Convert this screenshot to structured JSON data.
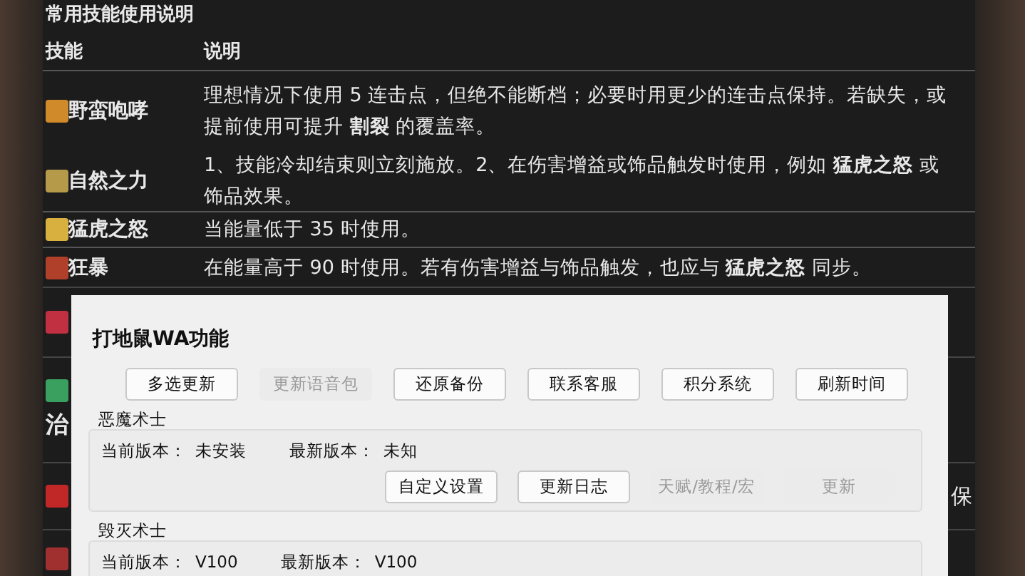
{
  "section_title": "常用技能使用说明",
  "table": {
    "columns": [
      "技能",
      "说明"
    ],
    "rows": [
      {
        "skill": "野蛮咆哮",
        "color": "#d08a2a",
        "description": "理想情况下使用 5 连击点，但绝不能断档；必要时用更少的连击点保持。若缺失，或提前使用可提升 **割裂** 的覆盖率。"
      },
      {
        "skill": "自然之力",
        "color": "#b59a4a",
        "description": "1、技能冷却结束则立刻施放。2、在伤害增益或饰品触发时使用，例如 **猛虎之怒** 或饰品效果。"
      },
      {
        "skill": "猛虎之怒",
        "color": "#d8b040",
        "description": "当能量低于 35 时使用。"
      },
      {
        "skill": "狂暴",
        "color": "#b0402a",
        "description": "在能量高于 90 时使用。若有伤害增益与饰品触发，也应与 **猛虎之怒** 同步。"
      }
    ],
    "covered_rows": [
      {
        "color": "#c03040"
      },
      {
        "color": "#3aa060",
        "skill": "治"
      },
      {
        "color": "#c02828",
        "description": "保"
      },
      {
        "color": "#a03030"
      }
    ]
  },
  "dialog": {
    "title": "打地鼠WA功能",
    "toolbar": [
      {
        "label": "多选更新",
        "disabled": false
      },
      {
        "label": "更新语音包",
        "disabled": true
      },
      {
        "label": "还原备份",
        "disabled": false
      },
      {
        "label": "联系客服",
        "disabled": false
      },
      {
        "label": "积分系统",
        "disabled": false
      },
      {
        "label": "刷新时间",
        "disabled": false
      }
    ],
    "groups": [
      {
        "title": "恶魔术士",
        "current_label": "当前版本：",
        "current": "未安装",
        "latest_label": "最新版本：",
        "latest": "未知",
        "actions": [
          {
            "label": "自定义设置",
            "disabled": false
          },
          {
            "label": "更新日志",
            "disabled": false
          },
          {
            "label": "天赋/教程/宏",
            "disabled": true
          },
          {
            "label": "更新",
            "disabled": true
          }
        ]
      },
      {
        "title": "毁灭术士",
        "current_label": "当前版本：",
        "current": "V100",
        "latest_label": "最新版本：",
        "latest": "V100"
      }
    ]
  }
}
